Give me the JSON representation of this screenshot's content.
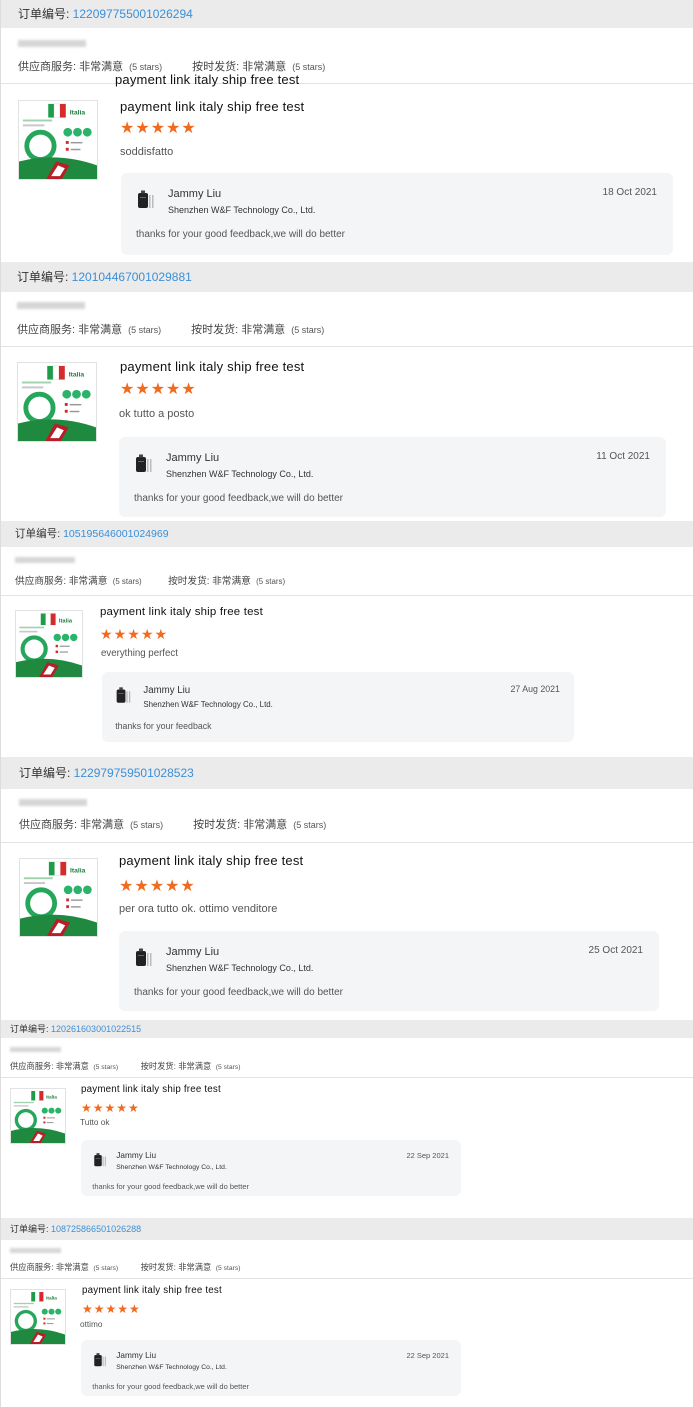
{
  "labels": {
    "order_prefix": "订单编号: ",
    "service_label": "供应商服务: 非常满意",
    "delivery_label": "按时发货: 非常满意",
    "stars_text": "(5 stars)",
    "rating_stars": "★★★★★",
    "thumb_text": "Italia"
  },
  "floating_title": "payment link italy ship free test",
  "reviews": [
    {
      "order_number": "1220977550010262​94",
      "product_title": "payment link italy ship free test",
      "comment": "soddisfatto",
      "seller_name": "Jammy Liu",
      "seller_company": "Shenzhen W&F Technology Co., Ltd.",
      "reply_date": "18 Oct 2021",
      "reply_text": "thanks for your good feedback,we will do better"
    },
    {
      "order_number": "120104467001029881",
      "product_title": "payment link italy ship free test",
      "comment": "ok tutto a posto",
      "seller_name": "Jammy Liu",
      "seller_company": "Shenzhen W&F Technology Co., Ltd.",
      "reply_date": "11 Oct 2021",
      "reply_text": "thanks for your good feedback,we will do better"
    },
    {
      "order_number": "105195646001024969",
      "product_title": "payment link italy ship free test",
      "comment": "everything perfect",
      "seller_name": "Jammy Liu",
      "seller_company": "Shenzhen W&F Technology Co., Ltd.",
      "reply_date": "27 Aug 2021",
      "reply_text": "thanks for your feedback"
    },
    {
      "order_number": "122979759501028523",
      "product_title": "payment link italy ship free test",
      "comment": "per ora tutto ok. ottimo venditore",
      "seller_name": "Jammy Liu",
      "seller_company": "Shenzhen W&F Technology Co., Ltd.",
      "reply_date": "25 Oct 2021",
      "reply_text": "thanks for your good feedback,we will do better"
    },
    {
      "order_number": "120261603001022515",
      "product_title": "payment link italy ship free test",
      "comment": "Tutto ok",
      "seller_name": "Jammy Liu",
      "seller_company": "Shenzhen W&F Technology Co., Ltd.",
      "reply_date": "22 Sep 2021",
      "reply_text": "thanks for your good feedback,we will do better"
    },
    {
      "order_number": "108725866501026288",
      "product_title": "payment link italy ship free test",
      "comment": "ottimo",
      "seller_name": "Jammy Liu",
      "seller_company": "Shenzhen W&F Technology Co., Ltd.",
      "reply_date": "22 Sep 2021",
      "reply_text": "thanks for your good feedback,we will do better"
    }
  ]
}
